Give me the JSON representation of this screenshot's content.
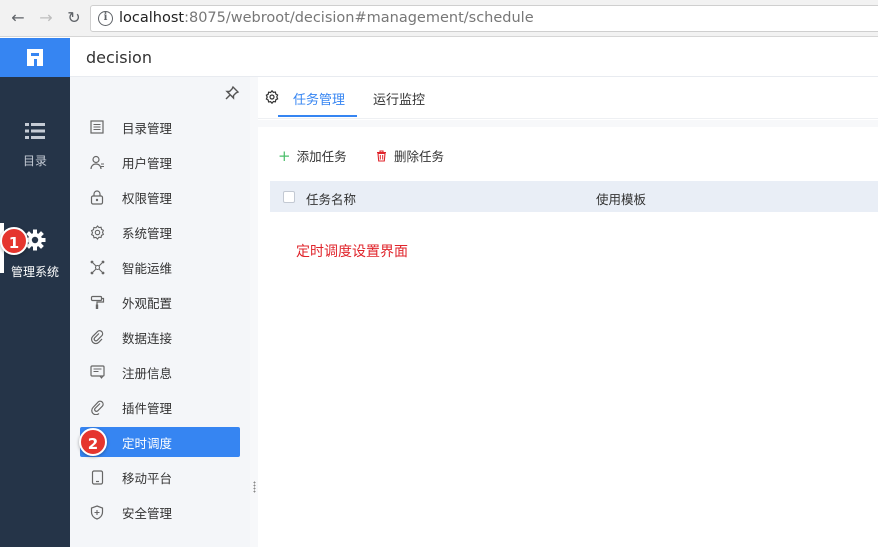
{
  "browser": {
    "url_host": "localhost",
    "url_rest": ":8075/webroot/decision#management/schedule"
  },
  "header": {
    "app_title": "decision"
  },
  "rail": {
    "items": [
      {
        "label": "目录",
        "icon": "list-icon"
      },
      {
        "label": "管理系统",
        "icon": "gear-icon",
        "active": true
      }
    ]
  },
  "submenu": {
    "items": [
      {
        "label": "目录管理",
        "icon": "catalog-icon"
      },
      {
        "label": "用户管理",
        "icon": "user-icon"
      },
      {
        "label": "权限管理",
        "icon": "lock-icon"
      },
      {
        "label": "系统管理",
        "icon": "settings-icon"
      },
      {
        "label": "智能运维",
        "icon": "network-icon"
      },
      {
        "label": "外观配置",
        "icon": "paint-roller-icon"
      },
      {
        "label": "数据连接",
        "icon": "link-icon"
      },
      {
        "label": "注册信息",
        "icon": "register-icon"
      },
      {
        "label": "插件管理",
        "icon": "plugin-icon"
      },
      {
        "label": "定时调度",
        "icon": "clock-icon",
        "active": true
      },
      {
        "label": "移动平台",
        "icon": "mobile-icon"
      },
      {
        "label": "安全管理",
        "icon": "shield-icon"
      }
    ]
  },
  "tabs": [
    {
      "label": "任务管理",
      "active": true
    },
    {
      "label": "运行监控"
    }
  ],
  "actions": {
    "add": "添加任务",
    "delete": "删除任务"
  },
  "table": {
    "columns": [
      "任务名称",
      "使用模板"
    ]
  },
  "annotation": "定时调度设置界面",
  "badges": [
    "1",
    "2"
  ],
  "colors": {
    "accent": "#3685f2",
    "rail_bg": "#253448",
    "badge": "#e5352e",
    "annotation": "#e0242b"
  }
}
